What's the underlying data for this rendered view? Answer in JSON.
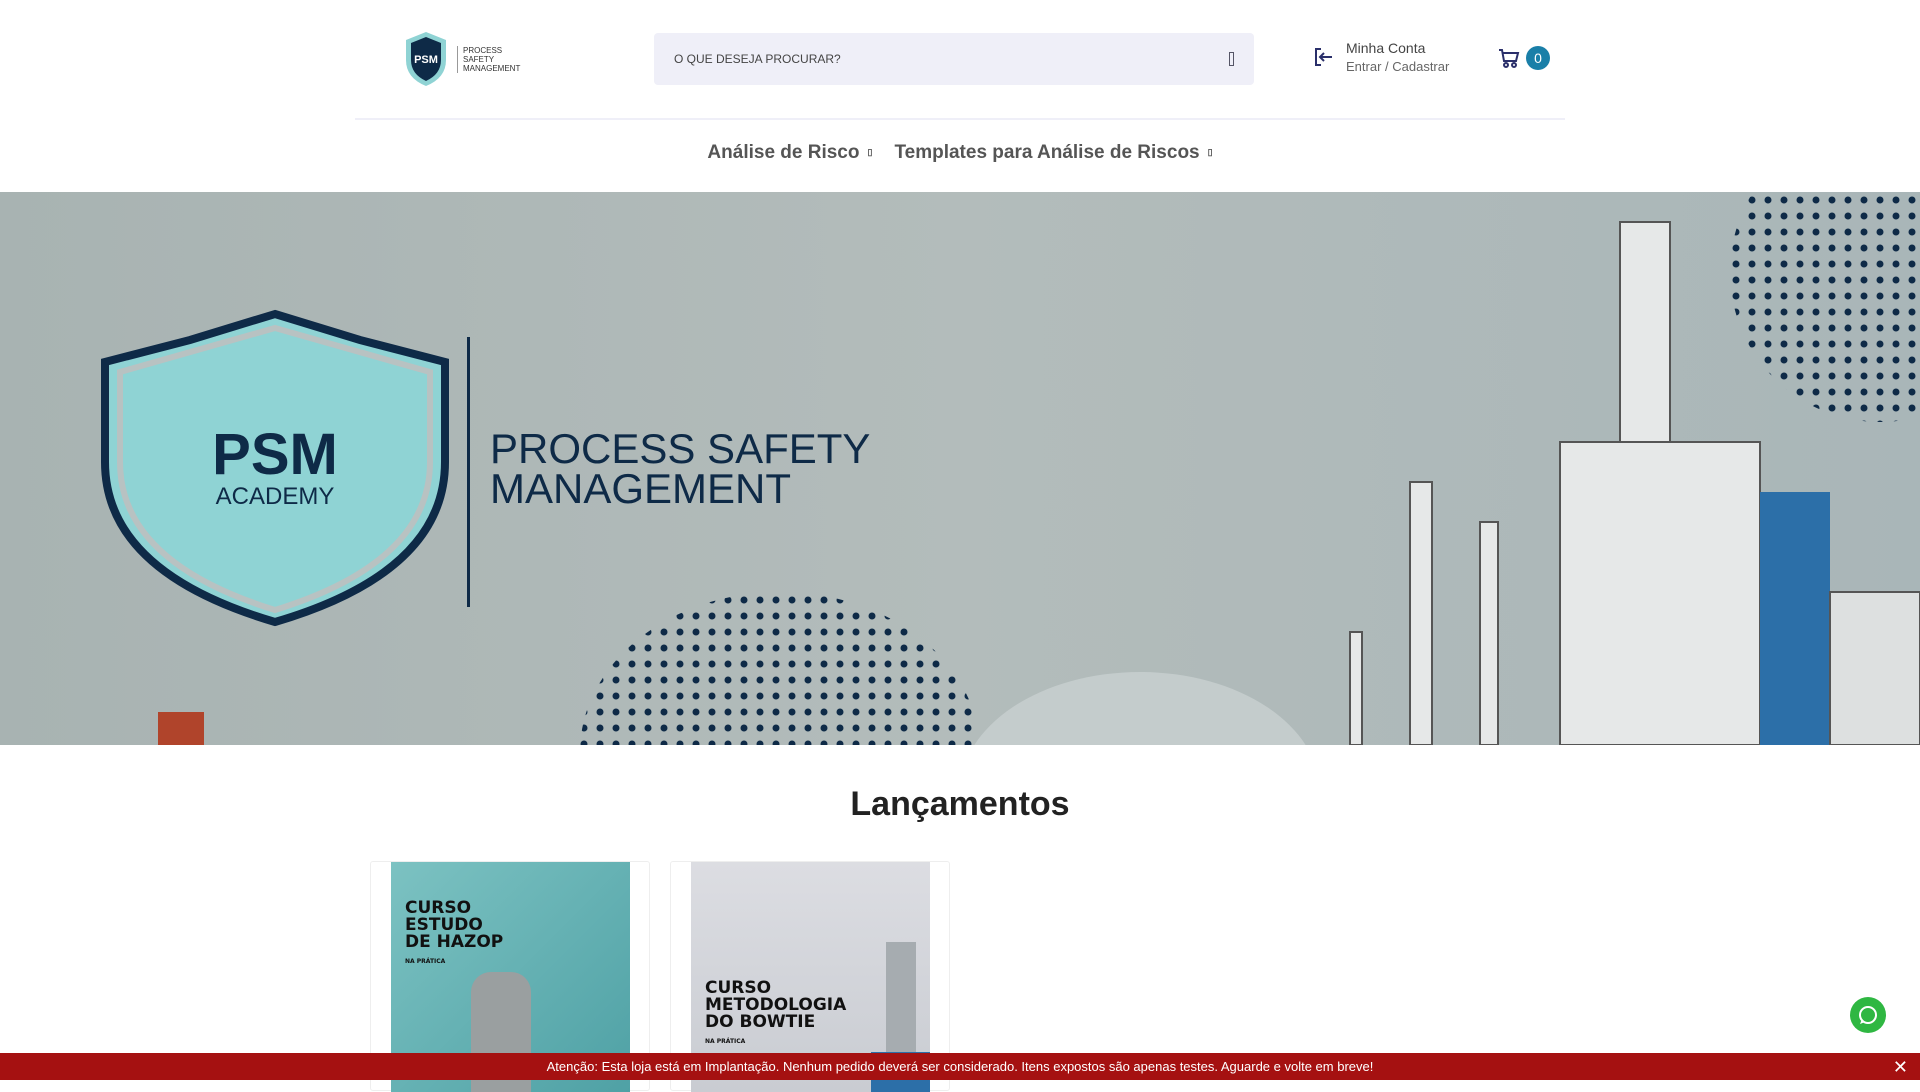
{
  "header": {
    "logo_text": "PROCESS SAFETY MANAGEMENT",
    "logo_badge": "PSM",
    "search_placeholder": "O QUE DESEJA PROCURAR?",
    "account_title": "Minha Conta",
    "account_sub": "Entrar / Cadastrar",
    "cart_count": "0"
  },
  "nav": [
    {
      "label": "Análise de Risco"
    },
    {
      "label": "Templates para Análise de Riscos"
    }
  ],
  "banner": {
    "badge_top": "PSM",
    "badge_sub": "ACADEMY",
    "line1": "PROCESS SAFETY",
    "line2": "MANAGEMENT"
  },
  "section_title": "Lançamentos",
  "products": [
    {
      "title": [
        "CURSO",
        "ESTUDO",
        "DE HAZOP"
      ],
      "sub": "NA PRÁTICA"
    },
    {
      "title": [
        "CURSO",
        "METODOLOGIA",
        "DO BOWTIE"
      ],
      "sub": "NA PRÁTICA"
    }
  ],
  "notice": {
    "text": "Atenção: Esta loja está em Implantação. Nenhum pedido deverá ser considerado. Itens expostos são apenas testes. Aguarde e volte em breve!",
    "close": "✕"
  },
  "colors": {
    "accent": "#1a7fa8",
    "notice": "#a51111",
    "navy": "#0e2a47",
    "teal": "#8fd3d4"
  }
}
